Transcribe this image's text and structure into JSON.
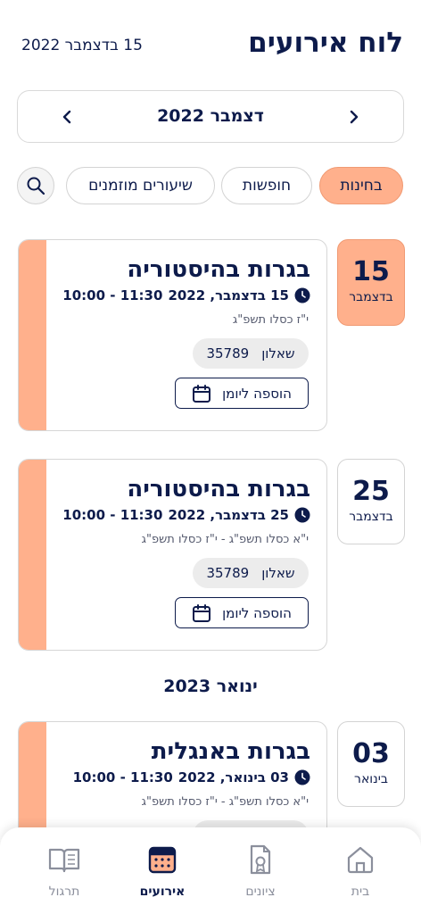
{
  "header": {
    "title": "לוח אירועים",
    "today": "15 בדצמבר 2022"
  },
  "month_nav": {
    "label": "דצמבר 2022"
  },
  "filters": {
    "chips": [
      "בחינות",
      "חופשות",
      "שיעורים מוזמנים"
    ],
    "active": "בחינות"
  },
  "events": [
    {
      "day": "15",
      "month": "בדצמבר",
      "title": "בגרות בהיסטוריה",
      "date_text": "15 בדצמבר, 2022",
      "time_text": "11:30 - 10:00",
      "hebrew_date": "י\"ז כסלו תשפ\"ג",
      "form_label": "שאלון",
      "form_number": "35789",
      "add_label": "הוספה ליומן"
    },
    {
      "day": "25",
      "month": "בדצמבר",
      "title": "בגרות בהיסטוריה",
      "date_text": "25 בדצמבר, 2022",
      "time_text": "11:30 - 10:00",
      "hebrew_date": "י\"א כסלו תשפ\"ג - י\"ז כסלו תשפ\"ג",
      "form_label": "שאלון",
      "form_number": "35789",
      "add_label": "הוספה ליומן"
    },
    {
      "day": "03",
      "month": "בינואר",
      "title": "בגרות באנגלית",
      "date_text": "03 בינואר, 2022",
      "time_text": "11:30 - 10:00",
      "hebrew_date": "י\"א כסלו תשפ\"ג - י\"ז כסלו תשפ\"ג"
    }
  ],
  "section_heading": "ינואר 2023",
  "bottom_nav": {
    "items": [
      "בית",
      "ציונים",
      "אירועים",
      "תרגול"
    ],
    "active": "אירועים"
  },
  "colors": {
    "accent": "#ffb08c",
    "navy": "#0d1b4b"
  }
}
